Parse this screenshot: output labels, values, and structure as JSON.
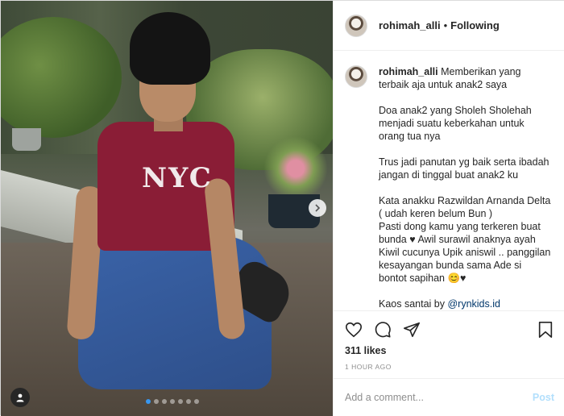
{
  "post": {
    "username": "rohimah_alli",
    "separator": "•",
    "follow_status": "Following",
    "caption": {
      "username": "rohimah_alli",
      "first_line": "Memberikan yang",
      "lines": [
        "terbaik aja untuk anak2 saya",
        "",
        "Doa anak2 yang Sholeh Sholehah",
        "menjadi suatu keberkahan untuk",
        "orang tua nya",
        "",
        "Trus jadi panutan yg baik serta ibadah",
        "jangan di tinggal buat anak2 ku",
        "",
        "Kata anakku Razwildan Arnanda Delta",
        "( udah keren belum Bun )",
        "Pasti dong kamu yang terkeren buat",
        "bunda ♥ Awil surawil anaknya ayah",
        "Kiwil cucunya Upik aniswil .. panggilan",
        "kesayangan bunda sama Ade si",
        "bontot sapihan 😊♥",
        ""
      ],
      "last_prefix": "Kaos santai by ",
      "mention": "@rynkids.id"
    },
    "likes": "311 likes",
    "timestamp": "1 HOUR AGO",
    "comment_placeholder": "Add a comment...",
    "post_button": "Post"
  },
  "photo": {
    "shirt_text": "NYC",
    "carousel_dots": 7,
    "active_dot": 0
  },
  "icons": {
    "like": "heart-icon",
    "comment": "comment-icon",
    "share": "share-icon",
    "save": "bookmark-icon",
    "next": "chevron-right-icon",
    "tag": "user-tag-icon"
  },
  "colors": {
    "link": "#00376b",
    "post_disabled": "#b2dffc",
    "dot_active": "#3897f0"
  }
}
